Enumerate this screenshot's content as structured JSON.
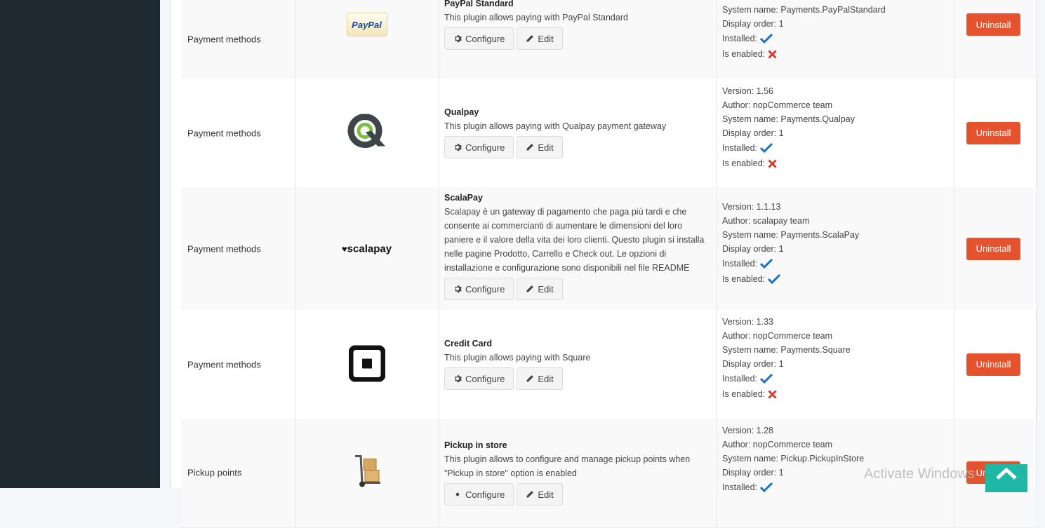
{
  "colors": {
    "accent_uninstall": "#e5532e",
    "check": "#1a73c8",
    "cross": "#d9382c",
    "sidebar": "#1e2830",
    "scroll_top": "#1fb7a6"
  },
  "labels": {
    "configure": "Configure",
    "edit": "Edit",
    "uninstall": "Uninstall",
    "installed": "Installed:",
    "is_enabled": "Is enabled:"
  },
  "plugins": [
    {
      "group": "Payment methods",
      "logo": "paypal-logo",
      "logo_text": "PayPal",
      "name": "PayPal Standard",
      "description": "This plugin allows paying with PayPal Standard",
      "version": "",
      "author": "",
      "system_name": "System name: Payments.PayPalStandard",
      "display_order": "Display order: 1",
      "installed": true,
      "enabled": false
    },
    {
      "group": "Payment methods",
      "logo": "qualpay-logo",
      "name": "Qualpay",
      "description": "This plugin allows paying with Qualpay payment gateway",
      "version": "Version: 1.56",
      "author": "Author: nopCommerce team",
      "system_name": "System name: Payments.Qualpay",
      "display_order": "Display order: 1",
      "installed": true,
      "enabled": false
    },
    {
      "group": "Payment methods",
      "logo": "scalapay-logo",
      "logo_text": "scalapay",
      "name": "ScalaPay",
      "description": "Scalapay è un gateway di pagamento che paga più tardi e che consente ai commercianti di aumentare le dimensioni del loro paniere e il valore della vita dei loro clienti. Questo plugin si installa nelle pagine Prodotto, Carrello e Check out. Le opzioni di installazione e configurazione sono disponibili nel file README",
      "version": "Version: 1.1.13",
      "author": "Author: scalapay team",
      "system_name": "System name: Payments.ScalaPay",
      "display_order": "Display order: 1",
      "installed": true,
      "enabled": true
    },
    {
      "group": "Payment methods",
      "logo": "square-logo",
      "name": "Credit Card",
      "description": "This plugin allows paying with Square",
      "version": "Version: 1.33",
      "author": "Author: nopCommerce team",
      "system_name": "System name: Payments.Square",
      "display_order": "Display order: 1",
      "installed": true,
      "enabled": false
    },
    {
      "group": "Pickup points",
      "logo": "hand-truck-logo",
      "name": "Pickup in store",
      "description": "This plugin allows to configure and manage pickup points when \"Pickup in store\" option is enabled",
      "version": "Version: 1.28",
      "author": "Author: nopCommerce team",
      "system_name": "System name: Pickup.PickupInStore",
      "display_order": "Display order: 1",
      "installed": true,
      "enabled": null
    }
  ],
  "watermark": "Activate Windows"
}
